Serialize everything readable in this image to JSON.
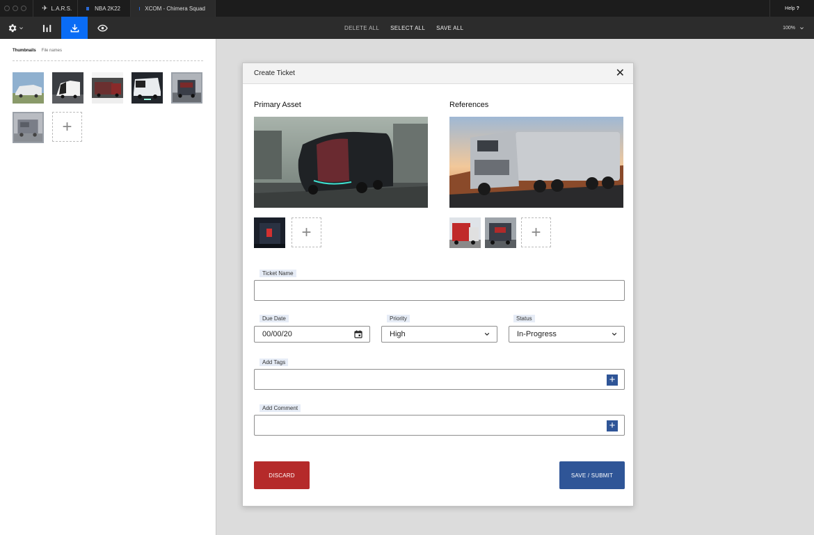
{
  "tabs": [
    {
      "label": "L.A.R.S."
    },
    {
      "label": "NBA 2K22"
    },
    {
      "label": "XCOM - Chimera Squad"
    }
  ],
  "help_label": "Help",
  "help_icon": "?",
  "toolbar": {
    "delete_all": "DELETE ALL",
    "select_all": "SELECT ALL",
    "save_all": "SAVE ALL",
    "zoom": "100%"
  },
  "left_panel": {
    "tab_thumbnails": "Thumbnails",
    "tab_filenames": "File names"
  },
  "modal": {
    "title": "Create Ticket",
    "primary_asset_label": "Primary Asset",
    "references_label": "References",
    "fields": {
      "ticket_name_label": "Ticket Name",
      "ticket_name_value": "",
      "due_date_label": "Due Date",
      "due_date_value": "00/00/20",
      "priority_label": "Priority",
      "priority_value": "High",
      "status_label": "Status",
      "status_value": "In-Progress",
      "tags_label": "Add Tags",
      "comment_label": "Add Comment"
    },
    "discard_label": "DISCARD",
    "save_label": "SAVE / SUBMIT"
  },
  "colors": {
    "accent_blue": "#0a6cf5",
    "primary_btn": "#2f5597",
    "danger_btn": "#b52a2a"
  }
}
